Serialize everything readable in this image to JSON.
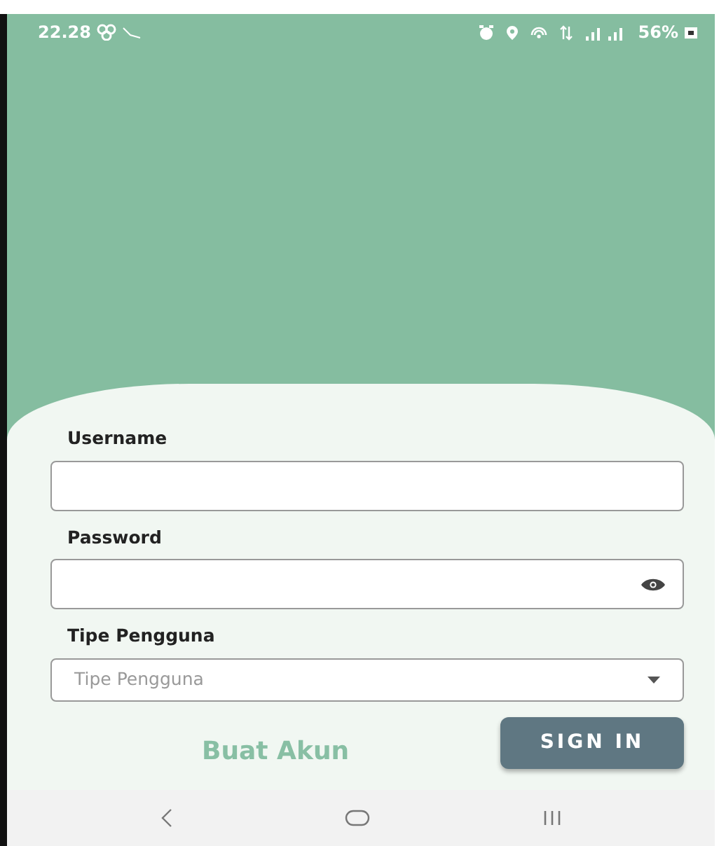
{
  "status_bar": {
    "time": "22.28",
    "battery": "56%"
  },
  "form": {
    "fields": [
      {
        "kind": "text",
        "label": "Username"
      },
      {
        "kind": "password",
        "label": "Password"
      },
      {
        "kind": "select",
        "label": "Tipe Pengguna",
        "placeholder": "Tipe Pengguna"
      }
    ],
    "create_account_link": "Buat Akun",
    "sign_in_button": "SIGN IN"
  }
}
